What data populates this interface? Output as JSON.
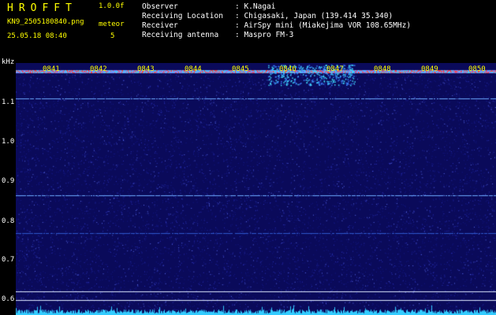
{
  "header": {
    "app_title": "HROFFT",
    "version": "1.0.0f",
    "filename": "KN9_2505180840.png",
    "mode": "meteor",
    "datetime": "25.05.18 08:40",
    "count": "5"
  },
  "info": {
    "rows": [
      {
        "label": "Observer",
        "value": ": K.Nagai"
      },
      {
        "label": "Receiving Location",
        "value": ": Chigasaki, Japan (139.414 35.340)"
      },
      {
        "label": "Receiver",
        "value": ": AirSpy mini (Miakejima VOR 108.65MHz)"
      },
      {
        "label": "Receiving antenna",
        "value": ": Maspro FM-3"
      }
    ]
  },
  "axis": {
    "unit": "kHz",
    "y_ticks": [
      "1.1",
      "1.0",
      "0.9",
      "0.8",
      "0.7",
      "0.6"
    ],
    "time_ticks": [
      "0841",
      "0842",
      "0843",
      "0844",
      "0845",
      "0846",
      "0847",
      "0848",
      "0849",
      "0850"
    ]
  },
  "colors": {
    "background": "#0a0a5a",
    "label_yellow": "#ffff00",
    "trace_cyan": "#33ccff",
    "line_white": "#dde8ff"
  }
}
